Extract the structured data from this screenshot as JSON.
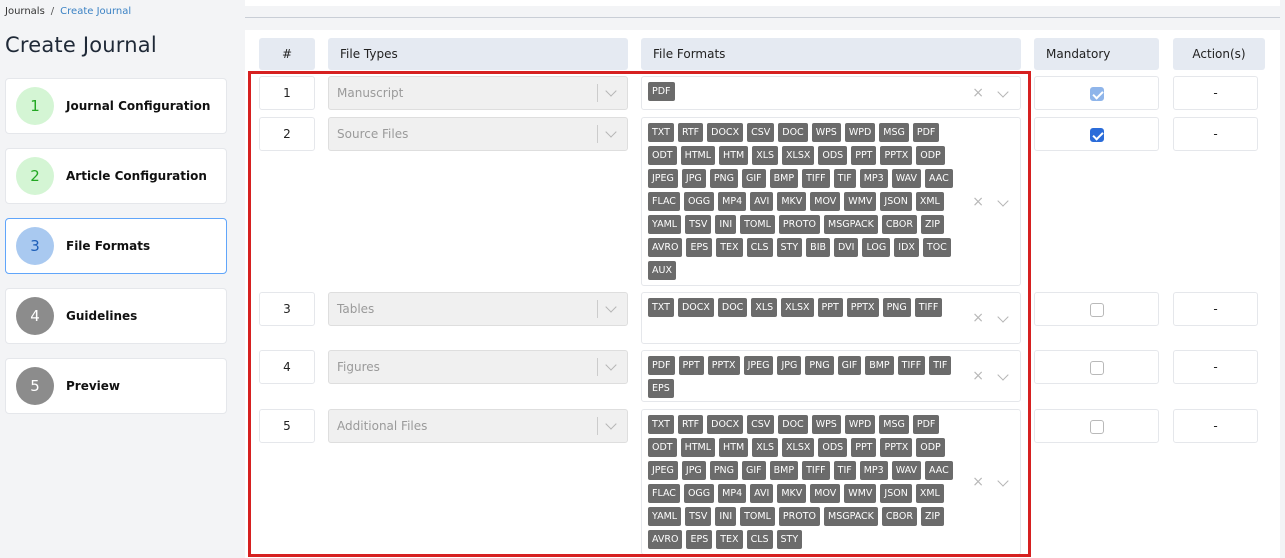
{
  "breadcrumb": {
    "root": "Journals",
    "separator": "/",
    "current": "Create Journal"
  },
  "page_title": "Create Journal",
  "steps": [
    {
      "num": "1",
      "label": "Journal Configuration",
      "circle_bg": "#d4f5d4",
      "circle_fg": "#22a722"
    },
    {
      "num": "2",
      "label": "Article Configuration",
      "circle_bg": "#d4f5d4",
      "circle_fg": "#22a722"
    },
    {
      "num": "3",
      "label": "File Formats",
      "circle_bg": "#a9c9f0",
      "circle_fg": "#1e5fb8",
      "active": true
    },
    {
      "num": "4",
      "label": "Guidelines",
      "circle_bg": "#8c8c8c",
      "circle_fg": "#ffffff"
    },
    {
      "num": "5",
      "label": "Preview",
      "circle_bg": "#8c8c8c",
      "circle_fg": "#ffffff"
    }
  ],
  "table": {
    "headers": {
      "num": "#",
      "file_types": "File Types",
      "file_formats": "File Formats",
      "mandatory": "Mandatory",
      "actions": "Action(s)"
    },
    "clear_glyph": "×",
    "rows": [
      {
        "num": "1",
        "file_type": "Manuscript",
        "mandatory": true,
        "mandatory_disabled": true,
        "action": "-",
        "formats": [
          "PDF"
        ]
      },
      {
        "num": "2",
        "file_type": "Source Files",
        "mandatory": true,
        "mandatory_disabled": false,
        "action": "-",
        "formats": [
          "TXT",
          "RTF",
          "DOCX",
          "CSV",
          "DOC",
          "WPS",
          "WPD",
          "MSG",
          "PDF",
          "ODT",
          "HTML",
          "HTM",
          "XLS",
          "XLSX",
          "ODS",
          "PPT",
          "PPTX",
          "ODP",
          "JPEG",
          "JPG",
          "PNG",
          "GIF",
          "BMP",
          "TIFF",
          "TIF",
          "MP3",
          "WAV",
          "AAC",
          "FLAC",
          "OGG",
          "MP4",
          "AVI",
          "MKV",
          "MOV",
          "WMV",
          "JSON",
          "XML",
          "YAML",
          "TSV",
          "INI",
          "TOML",
          "PROTO",
          "MSGPACK",
          "CBOR",
          "ZIP",
          "AVRO",
          "EPS",
          "TEX",
          "CLS",
          "STY",
          "BIB",
          "DVI",
          "LOG",
          "IDX",
          "TOC",
          "AUX"
        ]
      },
      {
        "num": "3",
        "file_type": "Tables",
        "mandatory": false,
        "mandatory_disabled": false,
        "action": "-",
        "formats": [
          "TXT",
          "DOCX",
          "DOC",
          "XLS",
          "XLSX",
          "PPT",
          "PPTX",
          "PNG",
          "TIFF"
        ]
      },
      {
        "num": "4",
        "file_type": "Figures",
        "mandatory": false,
        "mandatory_disabled": false,
        "action": "-",
        "formats": [
          "PDF",
          "PPT",
          "PPTX",
          "JPEG",
          "JPG",
          "PNG",
          "GIF",
          "BMP",
          "TIFF",
          "TIF",
          "EPS"
        ]
      },
      {
        "num": "5",
        "file_type": "Additional Files",
        "mandatory": false,
        "mandatory_disabled": false,
        "action": "-",
        "formats": [
          "TXT",
          "RTF",
          "DOCX",
          "CSV",
          "DOC",
          "WPS",
          "WPD",
          "MSG",
          "PDF",
          "ODT",
          "HTML",
          "HTM",
          "XLS",
          "XLSX",
          "ODS",
          "PPT",
          "PPTX",
          "ODP",
          "JPEG",
          "JPG",
          "PNG",
          "GIF",
          "BMP",
          "TIFF",
          "TIF",
          "MP3",
          "WAV",
          "AAC",
          "FLAC",
          "OGG",
          "MP4",
          "AVI",
          "MKV",
          "MOV",
          "WMV",
          "JSON",
          "XML",
          "YAML",
          "TSV",
          "INI",
          "TOML",
          "PROTO",
          "MSGPACK",
          "CBOR",
          "ZIP",
          "AVRO",
          "EPS",
          "TEX",
          "CLS",
          "STY"
        ]
      }
    ]
  },
  "colors": {
    "highlight": "#d62020",
    "accent": "#2b6cd9",
    "tag": "#6b6b6b",
    "header_bg": "#e5eaf2"
  }
}
